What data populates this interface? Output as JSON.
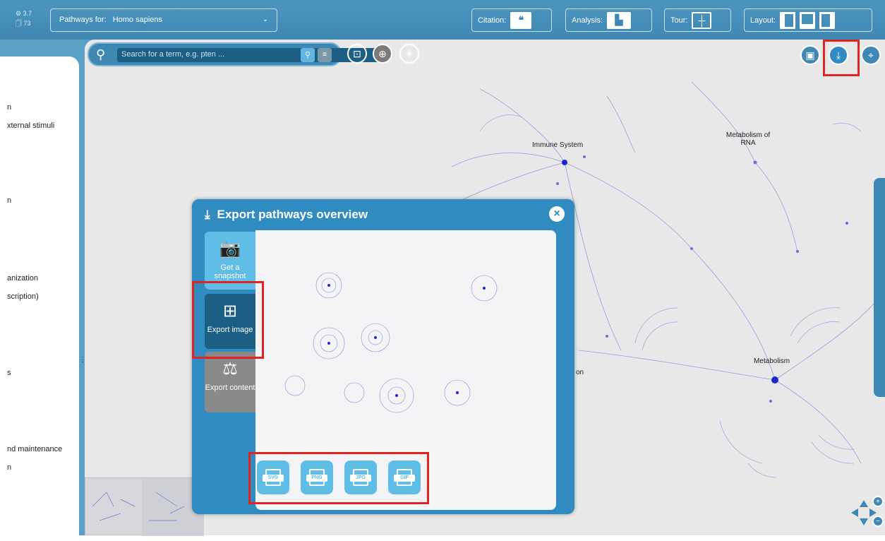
{
  "topbar": {
    "version_lines": [
      "⚙ 3.7",
      "🗍 73"
    ],
    "species_prefix": "Pathways for:",
    "species_value": "Homo sapiens",
    "citation_label": "Citation:",
    "analysis_label": "Analysis:",
    "tour_label": "Tour:",
    "layout_label": "Layout:"
  },
  "left_panel": {
    "items": [
      "n",
      "xternal stimuli",
      "n",
      "anization",
      "scription)",
      "s",
      "nd maintenance",
      "n"
    ]
  },
  "search": {
    "placeholder": "Search for a term, e.g. pten ...",
    "go_icon": "search-icon",
    "options_icon": "list-icon"
  },
  "canvas_labels": {
    "immune": "Immune System",
    "rna": "Metabolism of RNA",
    "metabolism": "Metabolism",
    "partial": "on"
  },
  "modal": {
    "title": "Export pathways overview",
    "tabs": [
      {
        "label": "Get a snapshot",
        "icon": "camera-icon"
      },
      {
        "label": "Export image",
        "icon": "diagram-icon"
      },
      {
        "label": "Export content",
        "icon": "scale-icon"
      }
    ],
    "formats": [
      "SVG",
      "PNG",
      "JPG",
      "GIF"
    ]
  },
  "colors": {
    "primary": "#3f88b3",
    "modal": "#2f8bc0",
    "highlight": "#e02323",
    "node": "#2d39c9"
  }
}
